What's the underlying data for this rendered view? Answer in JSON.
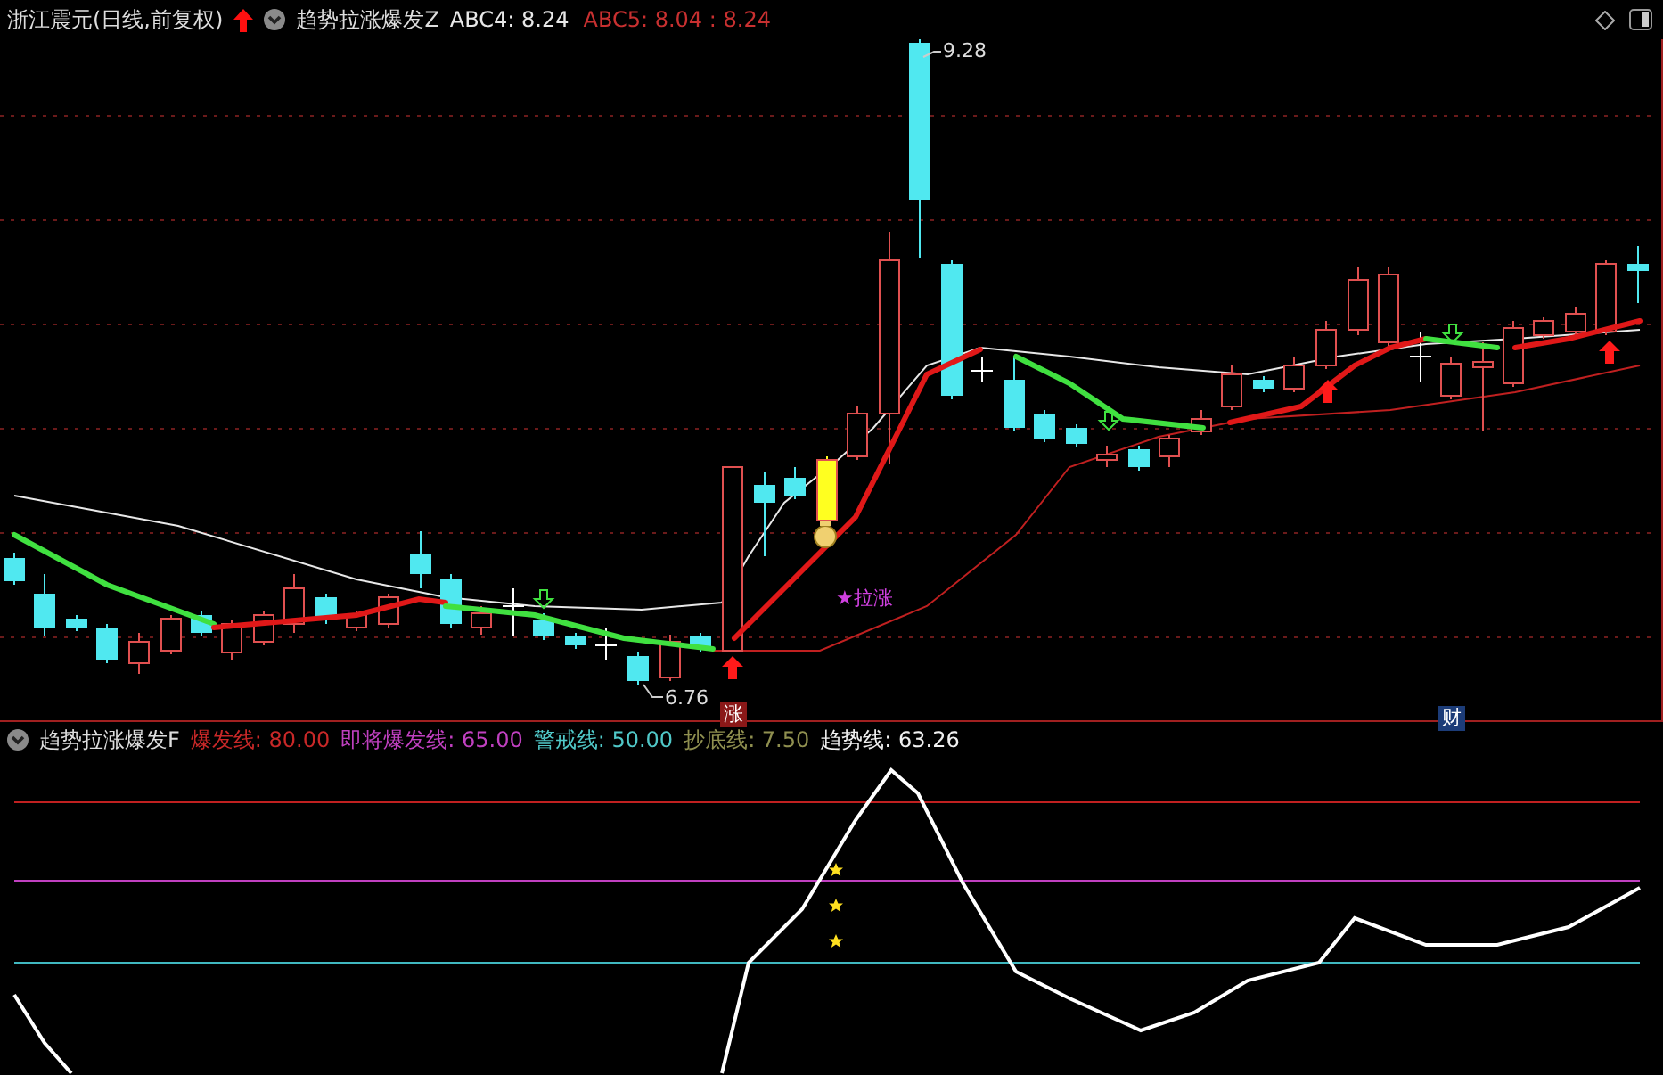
{
  "main_panel": {
    "stock_title": "浙江震元(日线,前复权)",
    "indicator_name": "趋势拉涨爆发Z",
    "readouts": [
      {
        "text": "ABC4: 8.24",
        "color": "#e8e8e8"
      },
      {
        "text": "ABC5: 8.04 : 8.24",
        "color": "#c83030"
      }
    ],
    "annotations": {
      "high_label": "9.28",
      "low_label": "6.76",
      "signal_label": "★拉涨"
    },
    "markers": [
      {
        "text": "涨",
        "color": "#8a1818"
      },
      {
        "text": "财",
        "color": "#1c3c78"
      }
    ]
  },
  "lower_panel": {
    "indicator_name": "趋势拉涨爆发F",
    "readouts": [
      {
        "text": "爆发线: 80.00",
        "color": "#c82828"
      },
      {
        "text": "即将爆发线: 65.00",
        "color": "#c040c0"
      },
      {
        "text": "警戒线: 50.00",
        "color": "#50c8c8"
      },
      {
        "text": "抄底线: 7.50",
        "color": "#909050"
      },
      {
        "text": "趋势线: 63.26",
        "color": "#f0f0f0"
      }
    ]
  }
}
